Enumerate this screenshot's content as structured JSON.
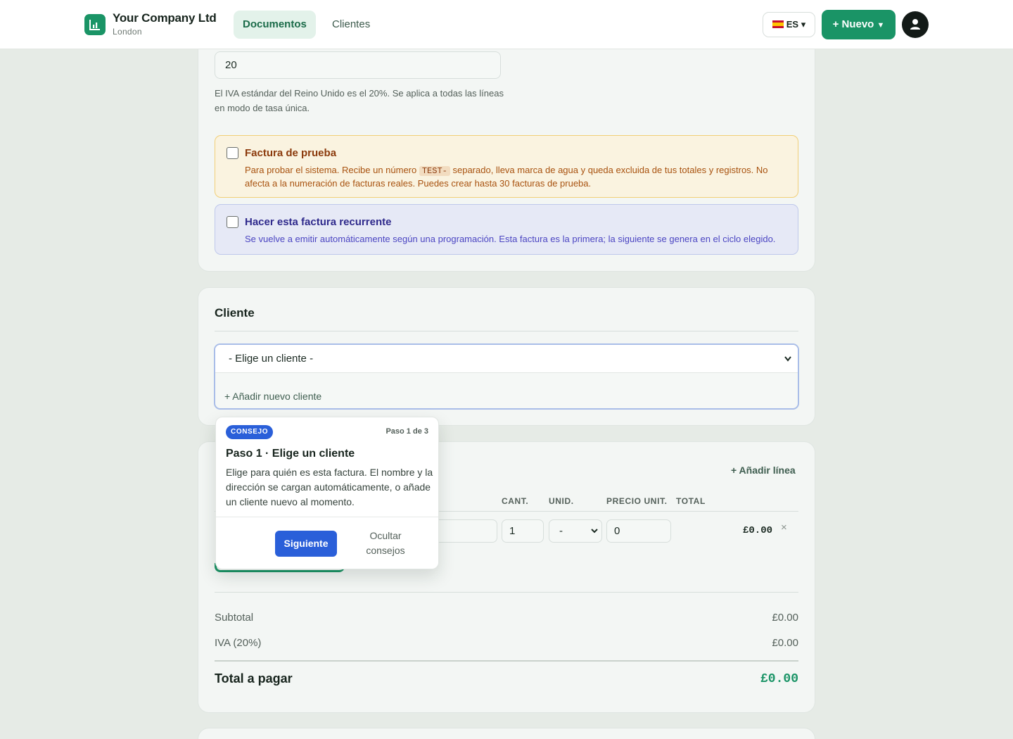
{
  "header": {
    "company_name": "Your Company Ltd",
    "company_city": "London",
    "nav": [
      {
        "label": "Documentos"
      },
      {
        "label": "Clientes"
      }
    ],
    "language": "ES",
    "new_button": "+ Nuevo"
  },
  "vat": {
    "value": "20",
    "help": "El IVA estándar del Reino Unido es el 20%. Se aplica a todas las líneas en modo de tasa única."
  },
  "test_invoice": {
    "title": "Factura de prueba",
    "text_before": "Para probar el sistema. Recibe un número ",
    "code": "TEST-",
    "text_after": " separado, lleva marca de agua y queda excluida de tus totales y registros. No afecta a la numeración de facturas reales. Puedes crear hasta 30 facturas de prueba."
  },
  "recurring": {
    "title": "Hacer esta factura recurrente",
    "text": "Se vuelve a emitir automáticamente según una programación. Esta factura es la primera; la siguiente se genera en el ciclo elegido."
  },
  "client": {
    "section_title": "Cliente",
    "select_value": "- Elige un cliente -",
    "add_new": "+ Añadir nuevo cliente"
  },
  "lines": {
    "add_line": "+ Añadir línea",
    "headers": {
      "qty": "CANT.",
      "unit": "UNID.",
      "unit_price": "PRECIO UNIT.",
      "total": "TOTAL"
    },
    "row": {
      "qty": "1",
      "unit": "-",
      "unit_price": "0",
      "total": "£0.00",
      "remove": "×"
    }
  },
  "summary": {
    "subtotal_label": "Subtotal",
    "subtotal_value": "£0.00",
    "vat_label": "IVA (20%)",
    "vat_value": "£0.00",
    "total_label": "Total a pagar",
    "total_value": "£0.00"
  },
  "tip": {
    "badge": "CONSEJO",
    "step": "Paso 1 de 3",
    "title": "Paso 1 · Elige un cliente",
    "text": "Elige para quién es esta factura. El nombre y la dirección se cargan automáticamente, o añade un cliente nuevo al momento.",
    "next": "Siguiente",
    "hide": "Ocultar consejos"
  },
  "colors": {
    "brand": "#1a9466",
    "accent_blue": "#2a5fd9",
    "warning_bg": "#faf3e0",
    "info_bg": "#e6e9f6"
  },
  "icons": {
    "logo": "bar-chart-icon",
    "avatar": "user-icon",
    "remove": "close-icon",
    "select": "chevron-down-icon"
  }
}
